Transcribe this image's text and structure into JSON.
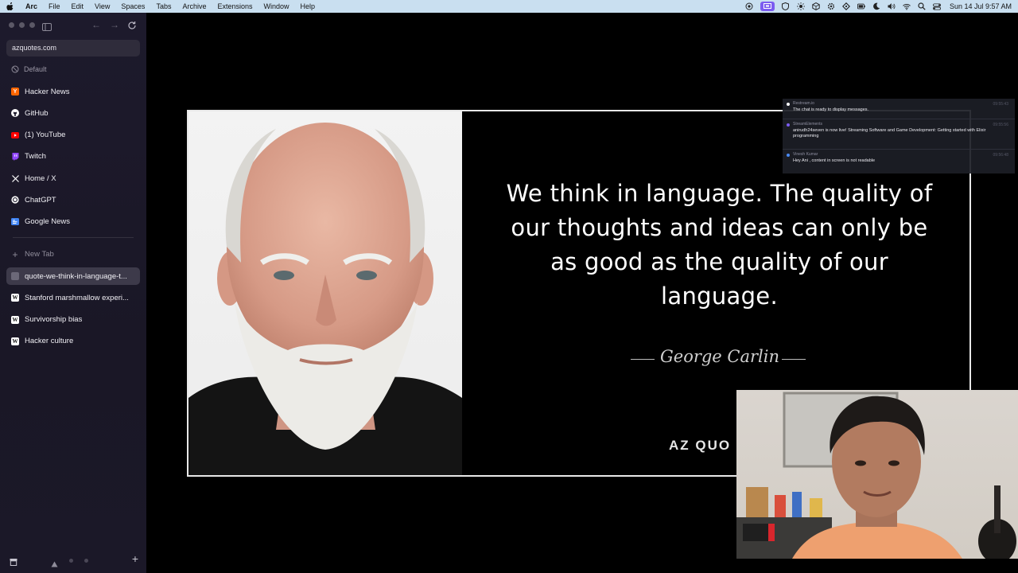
{
  "menubar": {
    "app": "Arc",
    "items": [
      "File",
      "Edit",
      "View",
      "Spaces",
      "Tabs",
      "Archive",
      "Extensions",
      "Window",
      "Help"
    ],
    "clock": "Sun 14 Jul  9:57 AM",
    "status_icons": [
      "screen-record-icon",
      "shield-icon",
      "brightness-icon",
      "box-icon",
      "gear-icon",
      "diamond-icon",
      "battery-icon",
      "moon-icon",
      "volume-icon",
      "wifi-icon",
      "search-icon",
      "control-center-icon"
    ]
  },
  "sidebar": {
    "url": "azquotes.com",
    "space_label": "Default",
    "pinned_tabs": [
      {
        "label": "Hacker News",
        "icon": "hacker-news-icon",
        "color": "#ff6600"
      },
      {
        "label": "GitHub",
        "icon": "github-icon",
        "color": "#ffffff"
      },
      {
        "label": "(1) YouTube",
        "icon": "youtube-icon",
        "color": "#ff0000"
      },
      {
        "label": "Twitch",
        "icon": "twitch-icon",
        "color": "#9146ff"
      },
      {
        "label": "Home / X",
        "icon": "x-icon",
        "color": "#ffffff"
      },
      {
        "label": "ChatGPT",
        "icon": "chatgpt-icon",
        "color": "#ffffff"
      },
      {
        "label": "Google News",
        "icon": "google-news-icon",
        "color": "#4285f4"
      }
    ],
    "new_tab_label": "New Tab",
    "tabs": [
      {
        "label": "quote-we-think-in-language-t...",
        "icon": "page-icon",
        "active": true
      },
      {
        "label": "Stanford marshmallow experi...",
        "icon": "wikipedia-icon",
        "active": false
      },
      {
        "label": "Survivorship bias",
        "icon": "wikipedia-icon",
        "active": false
      },
      {
        "label": "Hacker culture",
        "icon": "wikipedia-icon",
        "active": false
      }
    ]
  },
  "quote": {
    "text": "We think in language. The quality of our thoughts and ideas can only be as good as the quality of our language.",
    "author": "George Carlin",
    "brand": "AZ QUO"
  },
  "chat": {
    "messages": [
      {
        "user": "Restream.io",
        "time": "09:55:43",
        "text": "The chat is ready to display messages.",
        "dot": "#ffffff"
      },
      {
        "user": "StreamElements",
        "time": "09:55:56",
        "text": "anirudh24seven is now live! Streaming Software and Game Development: Getting started with Elixir programming",
        "dot": "#7c5cf0"
      },
      {
        "user": "Vinesh Kumar",
        "time": "09:56:48",
        "text": "Hey Ani , content in screen is not readable",
        "dot": "#4a8af4"
      }
    ]
  }
}
